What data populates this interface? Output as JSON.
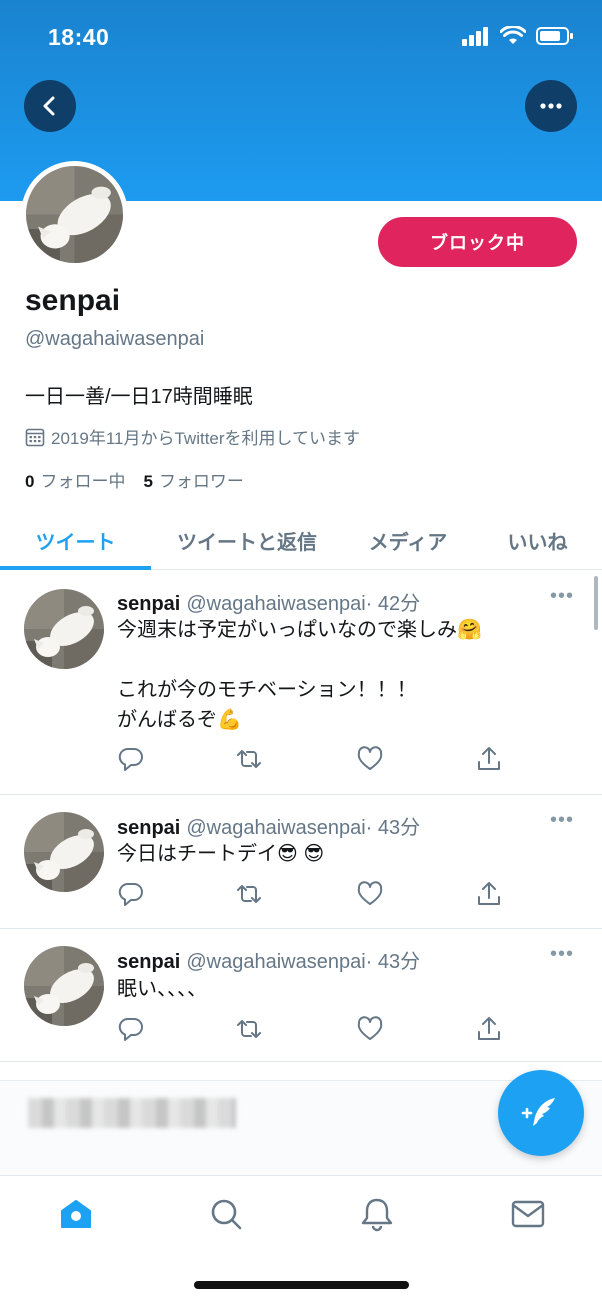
{
  "status_bar": {
    "time": "18:40"
  },
  "profile": {
    "display_name": "senpai",
    "handle": "@wagahaiwasenpai",
    "bio": "一日一善/一日17時間睡眠",
    "joined": "2019年11月からTwitterを利用しています",
    "following_count": "0",
    "following_label": "フォロー中",
    "followers_count": "5",
    "followers_label": "フォロワー",
    "block_button": "ブロック中"
  },
  "tabs": [
    {
      "label": "ツイート",
      "active": true
    },
    {
      "label": "ツイートと返信",
      "active": false
    },
    {
      "label": "メディア",
      "active": false
    },
    {
      "label": "いいね",
      "active": false
    }
  ],
  "tweets": [
    {
      "name": "senpai",
      "handle": "@wagahaiwasenpai",
      "time": "· 42分",
      "text": "今週末は予定がいっぱいなので楽しみ🤗\n\nこれが今のモチベーション！！！\nがんばるぞ💪"
    },
    {
      "name": "senpai",
      "handle": "@wagahaiwasenpai",
      "time": "· 43分",
      "text": "今日はチートデイ😎 😎"
    },
    {
      "name": "senpai",
      "handle": "@wagahaiwasenpai",
      "time": "· 43分",
      "text": "眠い、、、、"
    }
  ],
  "icons": {
    "back": "chevron-left-icon",
    "more": "more-horizontal-icon",
    "calendar": "calendar-icon",
    "reply": "reply-icon",
    "retweet": "retweet-icon",
    "like": "heart-icon",
    "share": "share-icon",
    "compose": "compose-icon",
    "home": "home-icon",
    "search": "search-icon",
    "notifications": "bell-icon",
    "messages": "mail-icon"
  },
  "colors": {
    "accent": "#1da1f2",
    "block": "#e0245e",
    "banner": "#1d9bf0",
    "muted": "#657786"
  }
}
